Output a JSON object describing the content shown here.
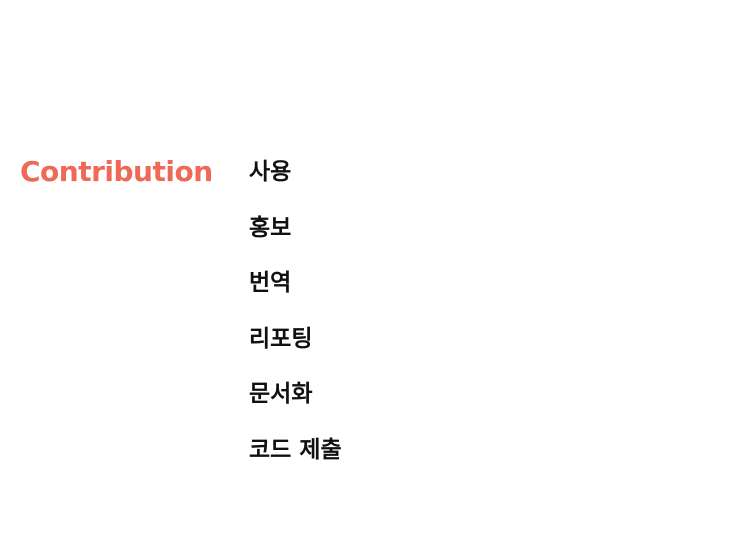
{
  "heading": "Contribution",
  "items": [
    "사용",
    "홍보",
    "번역",
    "리포팅",
    "문서화",
    "코드 제출"
  ],
  "colors": {
    "accent": "#ee6a57",
    "text": "#111111",
    "background": "#ffffff"
  }
}
